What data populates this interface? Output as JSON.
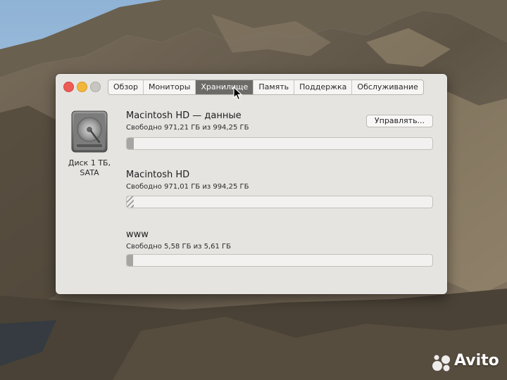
{
  "window": {
    "tabs": [
      {
        "label": "Обзор",
        "active": false
      },
      {
        "label": "Мониторы",
        "active": false
      },
      {
        "label": "Хранилище",
        "active": true
      },
      {
        "label": "Память",
        "active": false
      },
      {
        "label": "Поддержка",
        "active": false
      },
      {
        "label": "Обслуживание",
        "active": false
      }
    ],
    "disk_label": "Диск 1 ТБ, SATA",
    "manage_button": "Управлять...",
    "volumes": [
      {
        "name": "Macintosh HD — данные",
        "free_text": "Свободно 971,21 ГБ из 994,25 ГБ",
        "used_fraction": 0.023
      },
      {
        "name": "Macintosh HD",
        "free_text": "Свободно 971,01 ГБ из 994,25 ГБ",
        "used_fraction": 0.023
      },
      {
        "name": "www",
        "free_text": "Свободно 5,58 ГБ из 5,61 ГБ",
        "used_fraction": 0.005
      }
    ]
  },
  "watermark": {
    "text": "Avito"
  },
  "colors": {
    "active_tab": "#6d6b68",
    "close": "#ee5b55",
    "minimize": "#f2b73a",
    "zoom": "#c9c6c2"
  }
}
